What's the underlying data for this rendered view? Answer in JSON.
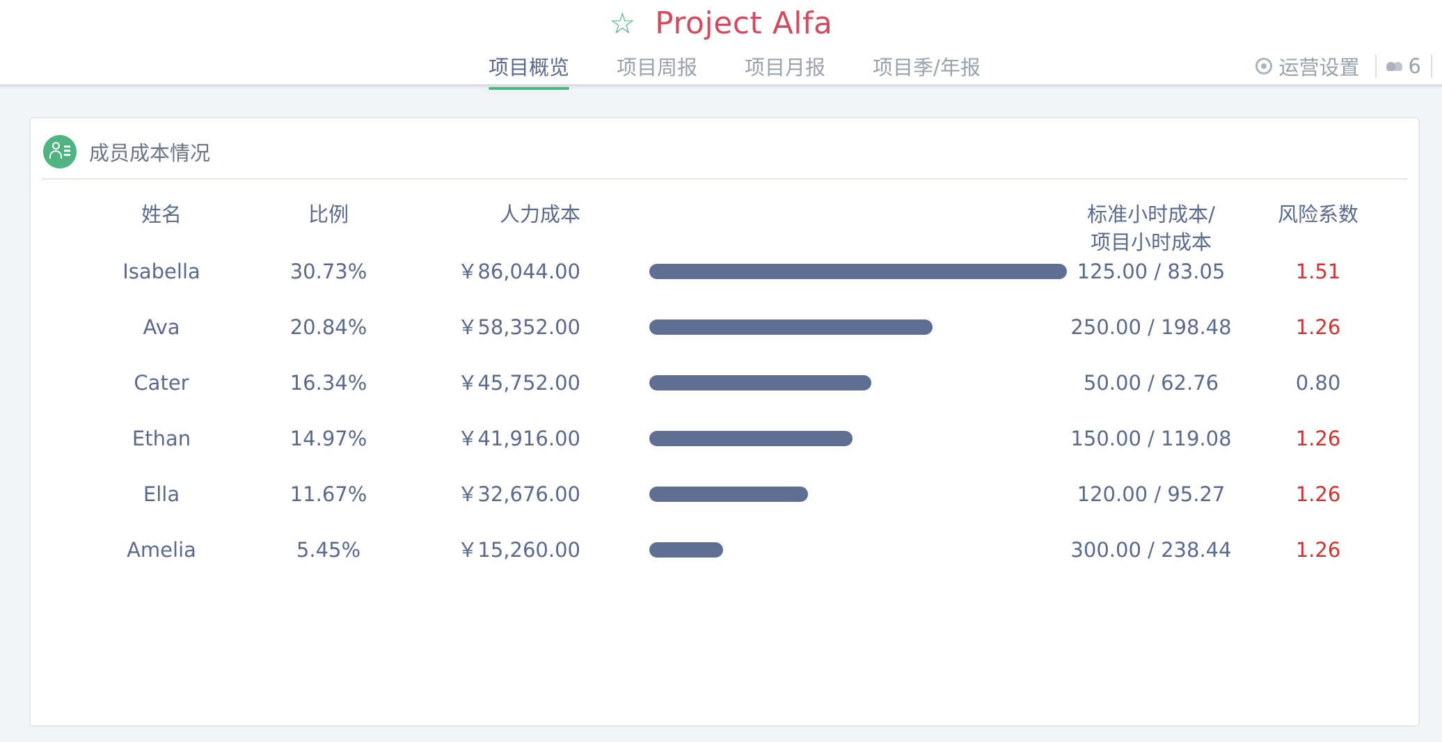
{
  "header": {
    "title": "Project Alfa",
    "star_icon": "☆",
    "tabs": [
      "项目概览",
      "项目周报",
      "项目月报",
      "项目季/年报"
    ],
    "active_tab_index": 0,
    "settings_label": "运营设置",
    "member_count": "6"
  },
  "card": {
    "title": "成员成本情况",
    "columns": {
      "name": "姓名",
      "ratio": "比例",
      "cost": "人力成本",
      "hours_line1": "标准小时成本/",
      "hours_line2": "项目小时成本",
      "risk": "风险系数"
    },
    "rows": [
      {
        "name": "Isabella",
        "ratio": "30.73%",
        "ratio_value": 30.73,
        "cost": "￥86,044.00",
        "hours": "125.00 / 83.05",
        "risk": "1.51",
        "risk_high": true
      },
      {
        "name": "Ava",
        "ratio": "20.84%",
        "ratio_value": 20.84,
        "cost": "￥58,352.00",
        "hours": "250.00 / 198.48",
        "risk": "1.26",
        "risk_high": true
      },
      {
        "name": "Cater",
        "ratio": "16.34%",
        "ratio_value": 16.34,
        "cost": "￥45,752.00",
        "hours": "50.00 / 62.76",
        "risk": "0.80",
        "risk_high": false
      },
      {
        "name": "Ethan",
        "ratio": "14.97%",
        "ratio_value": 14.97,
        "cost": "￥41,916.00",
        "hours": "150.00 / 119.08",
        "risk": "1.26",
        "risk_high": true
      },
      {
        "name": "Ella",
        "ratio": "11.67%",
        "ratio_value": 11.67,
        "cost": "￥32,676.00",
        "hours": "120.00 / 95.27",
        "risk": "1.26",
        "risk_high": true
      },
      {
        "name": "Amelia",
        "ratio": "5.45%",
        "ratio_value": 5.45,
        "cost": "￥15,260.00",
        "hours": "300.00 / 238.44",
        "risk": "1.26",
        "risk_high": true
      }
    ]
  },
  "colors": {
    "accent": "#4fb482",
    "title": "#d24a5e",
    "bar": "#5f6f93",
    "risk_high": "#d0332f",
    "text": "#5b6a8a"
  }
}
